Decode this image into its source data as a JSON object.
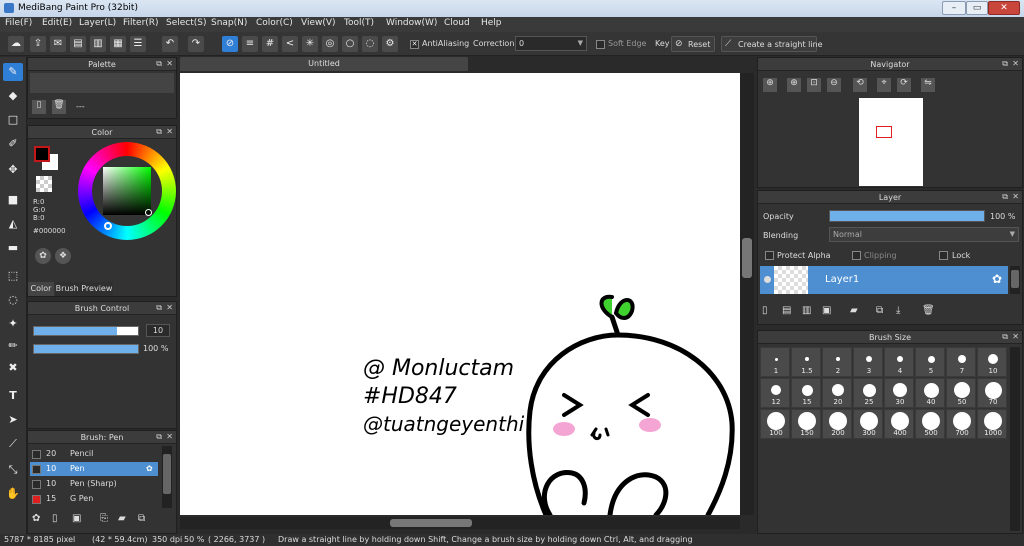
{
  "window": {
    "title": "MediBang Paint Pro (32bit)",
    "controls": [
      "–",
      "▭",
      "✕"
    ]
  },
  "menu": [
    "File(F)",
    "Edit(E)",
    "Layer(L)",
    "Filter(R)",
    "Select(S)",
    "Snap(N)",
    "Color(C)",
    "View(V)",
    "Tool(T)",
    "Window(W)",
    "Cloud",
    "Help"
  ],
  "toolbar": {
    "antialiasing_label": "AntiAliasing",
    "correction_label": "Correction",
    "correction_value": "0",
    "soft_edge_label": "Soft Edge",
    "key_label": "Key",
    "reset_label": "Reset",
    "straight_line_label": "Create a straight line"
  },
  "palette": {
    "title": "Palette",
    "name_placeholder": "---"
  },
  "color": {
    "title": "Color",
    "r": "R:0",
    "g": "G:0",
    "b": "B:0",
    "hex": "#000000",
    "tab_color": "Color",
    "tab_brush_preview": "Brush Preview"
  },
  "brush_control": {
    "title": "Brush Control",
    "size": "10",
    "opacity": "100 %",
    "size_fraction": 0.8,
    "opacity_fraction": 1.0
  },
  "brush_list": {
    "title": "Brush: Pen",
    "items": [
      {
        "size": "20",
        "name": "Pencil",
        "color": "#2a2a2a"
      },
      {
        "size": "10",
        "name": "Pen",
        "color": "#2a2a2a"
      },
      {
        "size": "10",
        "name": "Pen (Sharp)",
        "color": "#2a2a2a"
      },
      {
        "size": "15",
        "name": "G Pen",
        "color": "#e02020"
      }
    ],
    "selected": 1
  },
  "document": {
    "tab": "Untitled",
    "drawing_text": [
      "@ Monluctam",
      "#HD847",
      "@tuatngeyenthi"
    ]
  },
  "navigator": {
    "title": "Navigator"
  },
  "layer": {
    "title": "Layer",
    "opacity_label": "Opacity",
    "opacity_value": "100 %",
    "opacity_fraction": 1.0,
    "blending_label": "Blending",
    "blending_value": "Normal",
    "protect_alpha": "Protect Alpha",
    "clipping": "Clipping",
    "lock": "Lock",
    "layer_name": "Layer1"
  },
  "brush_size": {
    "title": "Brush Size",
    "sizes": [
      "1",
      "1.5",
      "2",
      "3",
      "4",
      "5",
      "7",
      "10",
      "12",
      "15",
      "20",
      "25",
      "30",
      "40",
      "50",
      "70",
      "100",
      "150",
      "200",
      "300",
      "400",
      "500",
      "700",
      "1000"
    ]
  },
  "status": {
    "dimensions": "5787 * 8185 pixel",
    "physical": "(42 * 59.4cm)",
    "dpi": "350 dpi",
    "zoom": "50 %",
    "coords": "( 2266, 3737 )",
    "hint": "Draw a straight line by holding down Shift, Change a brush size by holding down Ctrl, Alt, and dragging"
  },
  "colors": {
    "accent": "#2f7fd6",
    "layer_selected": "#4d8fd1",
    "sprout": "#3fd12e",
    "blush": "#f28fc8"
  }
}
